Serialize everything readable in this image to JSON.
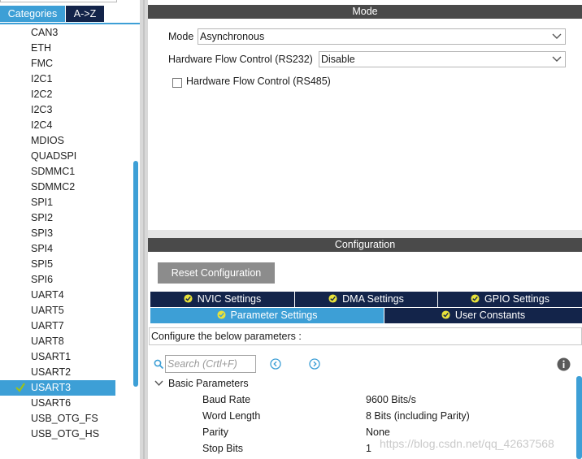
{
  "left_panel": {
    "tabs": {
      "categories": "Categories",
      "az": "A->Z"
    },
    "items": [
      {
        "label": "CAN3",
        "selected": false
      },
      {
        "label": "ETH",
        "selected": false
      },
      {
        "label": "FMC",
        "selected": false
      },
      {
        "label": "I2C1",
        "selected": false
      },
      {
        "label": "I2C2",
        "selected": false
      },
      {
        "label": "I2C3",
        "selected": false
      },
      {
        "label": "I2C4",
        "selected": false
      },
      {
        "label": "MDIOS",
        "selected": false
      },
      {
        "label": "QUADSPI",
        "selected": false
      },
      {
        "label": "SDMMC1",
        "selected": false
      },
      {
        "label": "SDMMC2",
        "selected": false
      },
      {
        "label": "SPI1",
        "selected": false
      },
      {
        "label": "SPI2",
        "selected": false
      },
      {
        "label": "SPI3",
        "selected": false
      },
      {
        "label": "SPI4",
        "selected": false
      },
      {
        "label": "SPI5",
        "selected": false
      },
      {
        "label": "SPI6",
        "selected": false
      },
      {
        "label": "UART4",
        "selected": false
      },
      {
        "label": "UART5",
        "selected": false
      },
      {
        "label": "UART7",
        "selected": false
      },
      {
        "label": "UART8",
        "selected": false
      },
      {
        "label": "USART1",
        "selected": false
      },
      {
        "label": "USART2",
        "selected": false
      },
      {
        "label": "USART3",
        "selected": true
      },
      {
        "label": "USART6",
        "selected": false
      },
      {
        "label": "USB_OTG_FS",
        "selected": false
      },
      {
        "label": "USB_OTG_HS",
        "selected": false
      }
    ]
  },
  "mode": {
    "title": "Mode",
    "mode_label": "Mode",
    "mode_value": "Asynchronous",
    "rs232_label": "Hardware Flow Control (RS232)",
    "rs232_value": "Disable",
    "rs485_label": "Hardware Flow Control (RS485)",
    "rs485_checked": false
  },
  "configuration": {
    "title": "Configuration",
    "reset_button": "Reset Configuration",
    "tabs": {
      "nvic": "NVIC Settings",
      "dma": "DMA Settings",
      "gpio": "GPIO Settings",
      "parameter": "Parameter Settings",
      "user_constants": "User Constants"
    },
    "info_text": "Configure the below parameters :",
    "search_placeholder": "Search (Crtl+F)",
    "group_title": "Basic Parameters",
    "params": [
      {
        "name": "Baud Rate",
        "value": "9600 Bits/s"
      },
      {
        "name": "Word Length",
        "value": "8 Bits (including Parity)"
      },
      {
        "name": "Parity",
        "value": "None"
      },
      {
        "name": "Stop Bits",
        "value": "1"
      }
    ]
  },
  "watermark": "https://blog.csdn.net/qq_42637568",
  "colors": {
    "accent": "#3d9fd6",
    "dark_navy": "#13244a",
    "header_gray": "#4a4a4a",
    "check_green": "#9cc11a"
  }
}
